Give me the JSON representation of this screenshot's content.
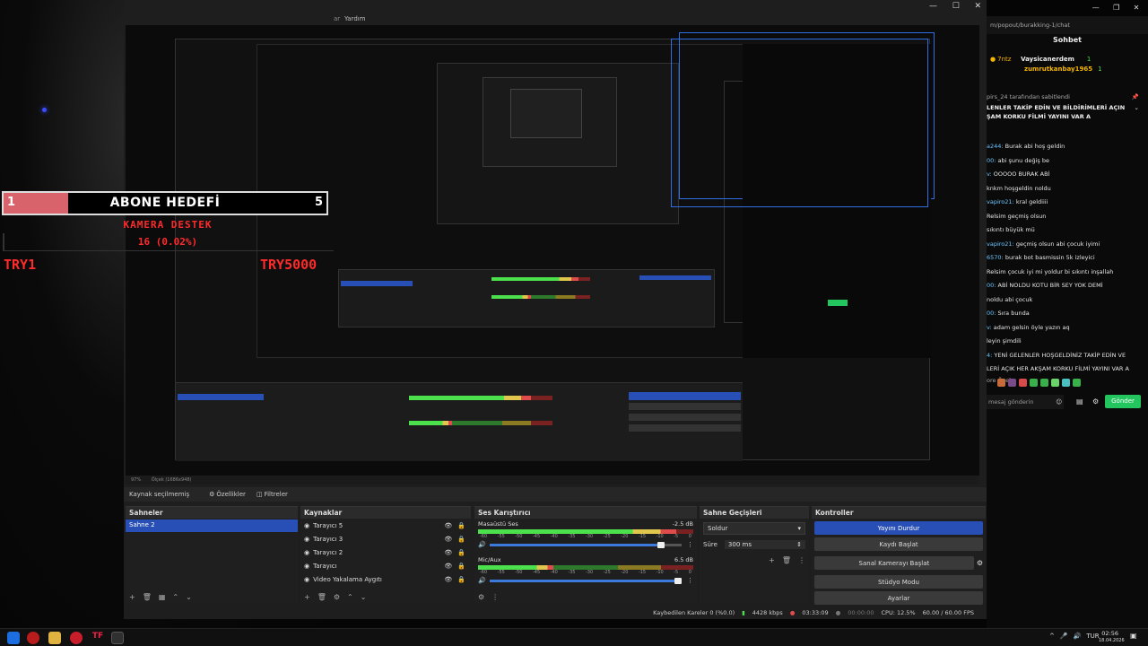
{
  "overlay": {
    "sub_goal_label": "ABONE HEDEFİ",
    "sub_goal_current": "1",
    "sub_goal_target": "5",
    "sub_goal_fraction": 0.2,
    "camera_support_label": "KAMERA DESTEK",
    "camera_support_value": "16 (0.02%)",
    "try_left": "TRY1",
    "try_right": "TRY5000"
  },
  "obs": {
    "menu_help": "Yardım",
    "window_controls": [
      "—",
      "☐",
      "✕"
    ],
    "zoom_label": "97%",
    "scale_label": "Ölçek (1686x948)",
    "no_source_selected": "Kaynak seçilmemiş",
    "properties_btn": "Özellikler",
    "filters_btn": "Filtreler",
    "scenes": {
      "title": "Sahneler",
      "items": [
        "Sahne 2"
      ]
    },
    "sources": {
      "title": "Kaynaklar",
      "items": [
        "Tarayıcı 5",
        "Tarayıcı 3",
        "Tarayıcı 2",
        "Tarayıcı",
        "Video Yakalama Aygıtı"
      ]
    },
    "mixer": {
      "title": "Ses Karıştırıcı",
      "channels": [
        {
          "name": "Masaüstü Ses",
          "db": "-2.5 dB",
          "level": 0.92,
          "volume": 0.91
        },
        {
          "name": "Mic/Aux",
          "db": "6.5 dB",
          "level": 0.35,
          "volume": 1.0
        }
      ],
      "ticks": [
        "-60",
        "-55",
        "-50",
        "-45",
        "-40",
        "-35",
        "-30",
        "-25",
        "-20",
        "-15",
        "-10",
        "-5",
        "0"
      ]
    },
    "transitions": {
      "title": "Sahne Geçişleri",
      "selected": "Soldur",
      "duration_label": "Süre",
      "duration_value": "300 ms"
    },
    "controls": {
      "title": "Kontroller",
      "buttons": [
        "Yayını Durdur",
        "Kaydı Başlat",
        "Sanal Kamerayı Başlat",
        "Stüdyo Modu",
        "Ayarlar"
      ]
    },
    "status": {
      "dropped": "Kaybedilen Kareler 0 (%0.0)",
      "bitrate": "4428 kbps",
      "stream_time": "03:33:09",
      "rec_time": "00:00:00",
      "cpu": "CPU: 12.5%",
      "fps": "60.00 / 60.00 FPS"
    }
  },
  "chat": {
    "url": "m/popout/burakking-1/chat",
    "title": "Sohbet",
    "top_users": [
      {
        "rank": "7ntz",
        "name": "Vaysicanerdem",
        "count": "1"
      },
      {
        "rank": "",
        "name": "zumrutkanbay1965",
        "count": "1"
      }
    ],
    "pinned_author": "pirs_24 tarafından sabitlendi",
    "pinned_text_1": "LENLER TAKİP EDİN VE BİLDİRİMLERİ AÇIN",
    "pinned_text_2": "ŞAM KORKU FİLMİ YAYINI VAR A",
    "messages": [
      {
        "user": "a244:",
        "text": "Burak abi hoş geldin"
      },
      {
        "user": "00:",
        "text": "abi şunu değiş be"
      },
      {
        "user": "v:",
        "text": "OOOOO BURAK ABİ"
      },
      {
        "user": "",
        "text": "knkm hoşgeldin noldu"
      },
      {
        "user": "vapiro21:",
        "text": "kral geldiiii"
      },
      {
        "user": "",
        "text": "Relsim geçmiş olsun"
      },
      {
        "user": "",
        "text": "sıkıntı büyük mü"
      },
      {
        "user": "vapiro21:",
        "text": "geçmiş olsun abi çocuk iyimi"
      },
      {
        "user": "6570:",
        "text": "burak bot basmissin 5k izleyici"
      },
      {
        "user": "",
        "text": "Relsim çocuk iyi mi yoldur bi sıkıntı inşallah"
      },
      {
        "user": "00:",
        "text": "ABİ NOLDU KOTU BİR SEY YOK DEMİ"
      },
      {
        "user": "",
        "text": "noldu abi çocuk"
      },
      {
        "user": "00:",
        "text": "Sıra bunda"
      },
      {
        "user": "v:",
        "text": "adam gelsin öyle yazın aq"
      },
      {
        "user": "",
        "text": "leyin şimdili"
      },
      {
        "user": "4:",
        "text": "YENİ GELENLER HOŞGELDİNİZ TAKİP EDİN VE"
      },
      {
        "user": "",
        "text": "LERİ AÇIK HER AKŞAM KORKU FİLMİ YAYINI VAR A"
      }
    ],
    "emote_label": "ore Özel",
    "input_placeholder": "mesaj gönderin",
    "send_button": "Gönder"
  },
  "taskbar": {
    "lang": "TUR",
    "time": "02:56",
    "date": "18.04.2026"
  },
  "colors": {
    "accent_blue": "#284fb5",
    "goal_fill": "#d9636a",
    "overlay_red": "#ff2b2b",
    "send_green": "#22c55e"
  }
}
